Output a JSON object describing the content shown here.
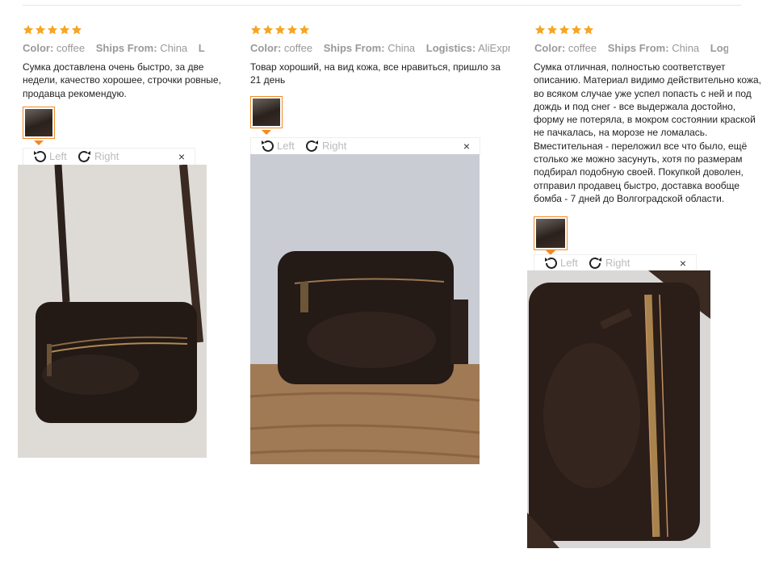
{
  "reviews": [
    {
      "rating": 5,
      "meta": [
        {
          "key": "Color:",
          "value": "coffee"
        },
        {
          "key": "Ships From:",
          "value": "China"
        },
        {
          "key": "Log",
          "value": ""
        }
      ],
      "text": "Сумка доставлена очень быстро, за две недели, качество хорошее, строчки ровные, продавца рекомендую.",
      "toolbar": {
        "left": "Left",
        "right": "Right",
        "close": "×"
      }
    },
    {
      "rating": 5,
      "meta": [
        {
          "key": "Color:",
          "value": "coffee"
        },
        {
          "key": "Ships From:",
          "value": "China"
        },
        {
          "key": "Logistics:",
          "value": "AliExpress"
        }
      ],
      "text": "Товар хороший, на вид кожа, все нравиться, пришло за 21 день",
      "toolbar": {
        "left": "Left",
        "right": "Right",
        "close": "×"
      }
    },
    {
      "rating": 5,
      "meta": [
        {
          "key": "Color:",
          "value": "coffee"
        },
        {
          "key": "Ships From:",
          "value": "China"
        },
        {
          "key": "Logist",
          "value": ""
        }
      ],
      "text": "Сумка отличная, полностью соответствует описанию. Материал видимо действительно кожа, во всяком случае уже успел попасть с ней и под дождь и под снег - все выдержала достойно, форму не потеряла, в мокром состоянии краской не пачкалась, на морозе не ломалась. Вместительная - переложил все что было, ещё столько же можно засунуть, хотя по размерам подбирал подобную своей. Покупкой доволен, отправил продавец быстро, доставка вообще бомба - 7 дней до Волгоградской области.",
      "toolbar": {
        "left": "Left",
        "right": "Right",
        "close": "×"
      }
    }
  ],
  "colors": {
    "star": "#f6a623",
    "accent": "#f08a24",
    "meta": "#999999"
  }
}
